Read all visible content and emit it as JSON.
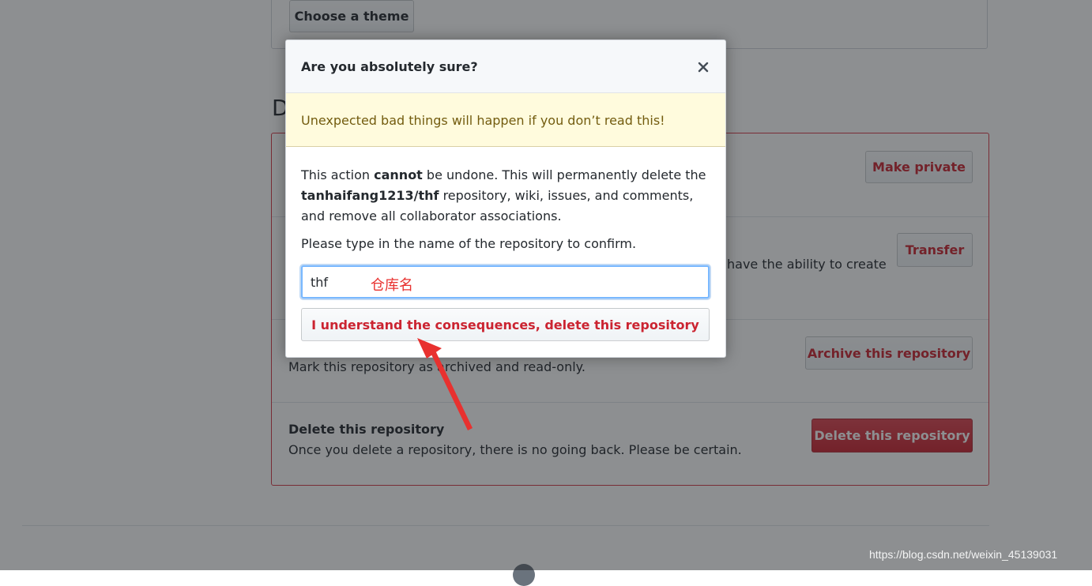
{
  "page": {
    "choose_theme_label": "Choose a theme",
    "danger_zone_heading": "D",
    "rows": {
      "visibility": {
        "button": "Make private"
      },
      "transfer": {
        "desc_fragment": "have the ability to create",
        "button": "Transfer"
      },
      "archive": {
        "desc": "Mark this repository as archived and read-only.",
        "button": "Archive this repository"
      },
      "delete": {
        "title": "Delete this repository",
        "desc": "Once you delete a repository, there is no going back. Please be certain.",
        "button": "Delete this repository"
      }
    }
  },
  "modal": {
    "title": "Are you absolutely sure?",
    "close_icon": "close-icon",
    "warning": "Unexpected bad things will happen if you don’t read this!",
    "body": {
      "part1": "This action ",
      "cannot": "cannot",
      "part2": " be undone. This will permanently delete the ",
      "repo": "tanhaifang1213/thf",
      "part3": " repository, wiki, issues, and comments, and remove all collaborator associations."
    },
    "confirm_label": "Please type in the name of the repository to confirm.",
    "input_value": "thf",
    "confirm_button": "I understand the consequences, delete this repository"
  },
  "annotation": {
    "label": "仓库名",
    "arrow_color": "#e8312f"
  },
  "watermark": "https://blog.csdn.net/weixin_45139031",
  "colors": {
    "danger": "#cb2431",
    "danger_border": "#d73a49",
    "warning_bg": "#fffbdd",
    "warning_text": "#735c0f",
    "focus": "#79b8ff"
  }
}
